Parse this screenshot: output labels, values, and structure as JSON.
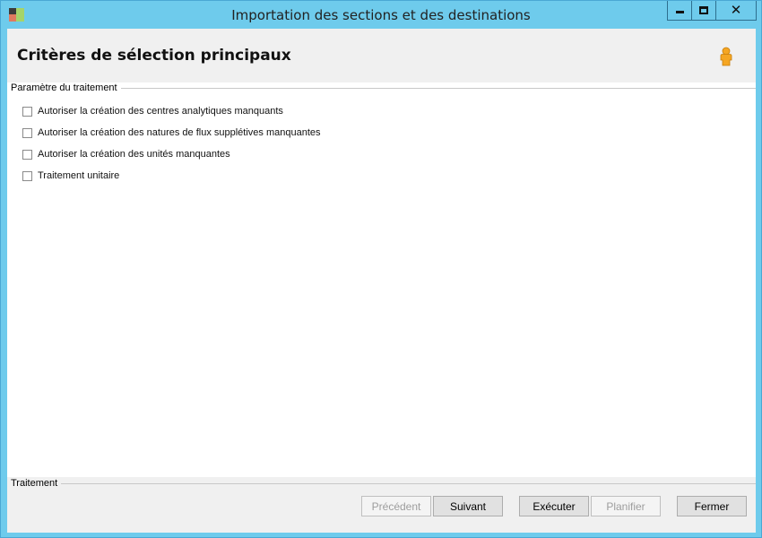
{
  "window": {
    "title": "Importation des sections et des destinations",
    "icon": "app-window-icon",
    "controls": {
      "minimize": "minimize-icon",
      "maximize": "maximize-icon",
      "close": "close-icon"
    }
  },
  "header": {
    "title": "Critères de sélection principaux",
    "icon": "user-icon",
    "icon_color": "#f5a623"
  },
  "parameters": {
    "group_label": "Paramètre du traitement",
    "options": [
      {
        "label": "Autoriser la création des centres analytiques manquants",
        "checked": false
      },
      {
        "label": "Autoriser la création des natures de flux supplétives manquantes",
        "checked": false
      },
      {
        "label": "Autoriser la création des unités manquantes",
        "checked": false
      },
      {
        "label": "Traitement unitaire",
        "checked": false
      }
    ]
  },
  "footer": {
    "group_label": "Traitement",
    "buttons": {
      "previous": {
        "label": "Précédent",
        "enabled": false
      },
      "next": {
        "label": "Suivant",
        "enabled": true
      },
      "execute": {
        "label": "Exécuter",
        "enabled": true
      },
      "schedule": {
        "label": "Planifier",
        "enabled": false
      },
      "close": {
        "label": "Fermer",
        "enabled": true
      }
    }
  },
  "colors": {
    "frame": "#6ecbec",
    "panel": "#f0f0f0",
    "content": "#ffffff"
  }
}
